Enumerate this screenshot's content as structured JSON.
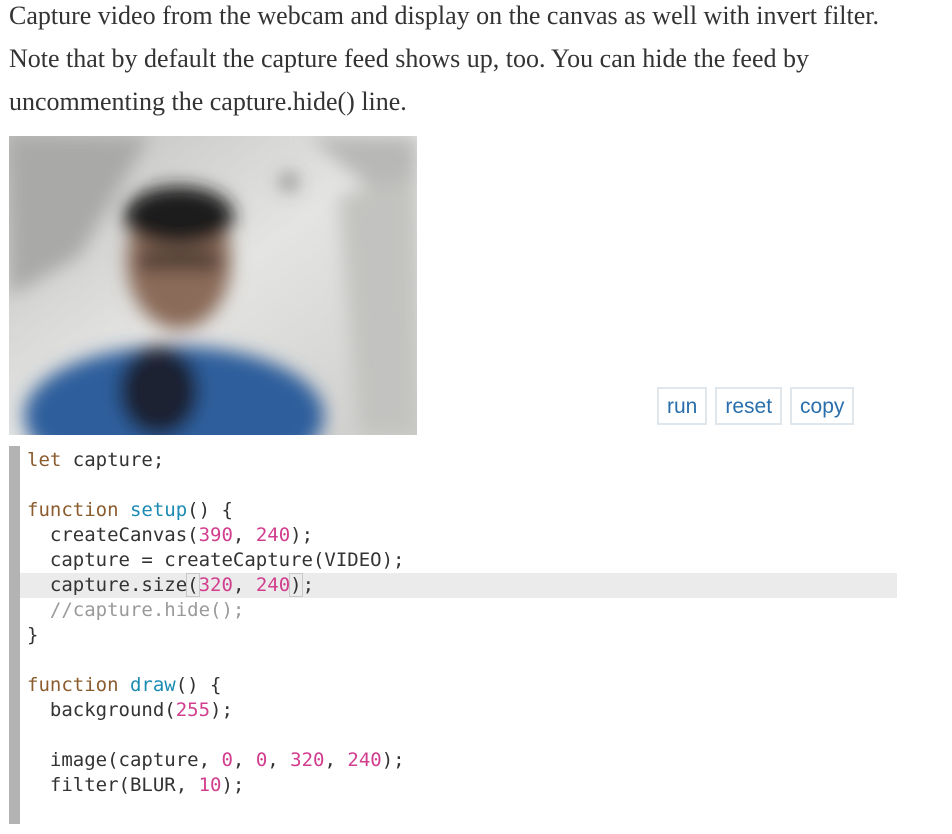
{
  "description": "Capture video from the webcam and display on the canvas as well with invert filter. Note that by default the capture feed shows up, too. You can hide the feed by uncommenting the capture.hide() line.",
  "buttons": {
    "run": "run",
    "reset": "reset",
    "copy": "copy"
  },
  "code": {
    "l1_kw": "let",
    "l1_rest": " capture;",
    "l3_kw": "function",
    "l3_fn": "setup",
    "l3_rest": "() {",
    "l4_a": "  createCanvas(",
    "l4_n1": "390",
    "l4_b": ", ",
    "l4_n2": "240",
    "l4_c": ");",
    "l5": "  capture = createCapture(VIDEO);",
    "l6_a": "  capture.size",
    "l6_b": "(",
    "l6_n1": "320",
    "l6_c": ", ",
    "l6_n2": "240",
    "l6_d": ")",
    "l6_e": ";",
    "l7": "  //capture.hide();",
    "l8": "}",
    "l10_kw": "function",
    "l10_fn": "draw",
    "l10_rest": "() {",
    "l11_a": "  background(",
    "l11_n": "255",
    "l11_b": ");",
    "l13_a": "  image(capture, ",
    "l13_n1": "0",
    "l13_b": ", ",
    "l13_n2": "0",
    "l13_c": ", ",
    "l13_n3": "320",
    "l13_d": ", ",
    "l13_n4": "240",
    "l13_e": ");",
    "l14_a": "  filter(BLUR, ",
    "l14_n": "10",
    "l14_b": ");"
  }
}
